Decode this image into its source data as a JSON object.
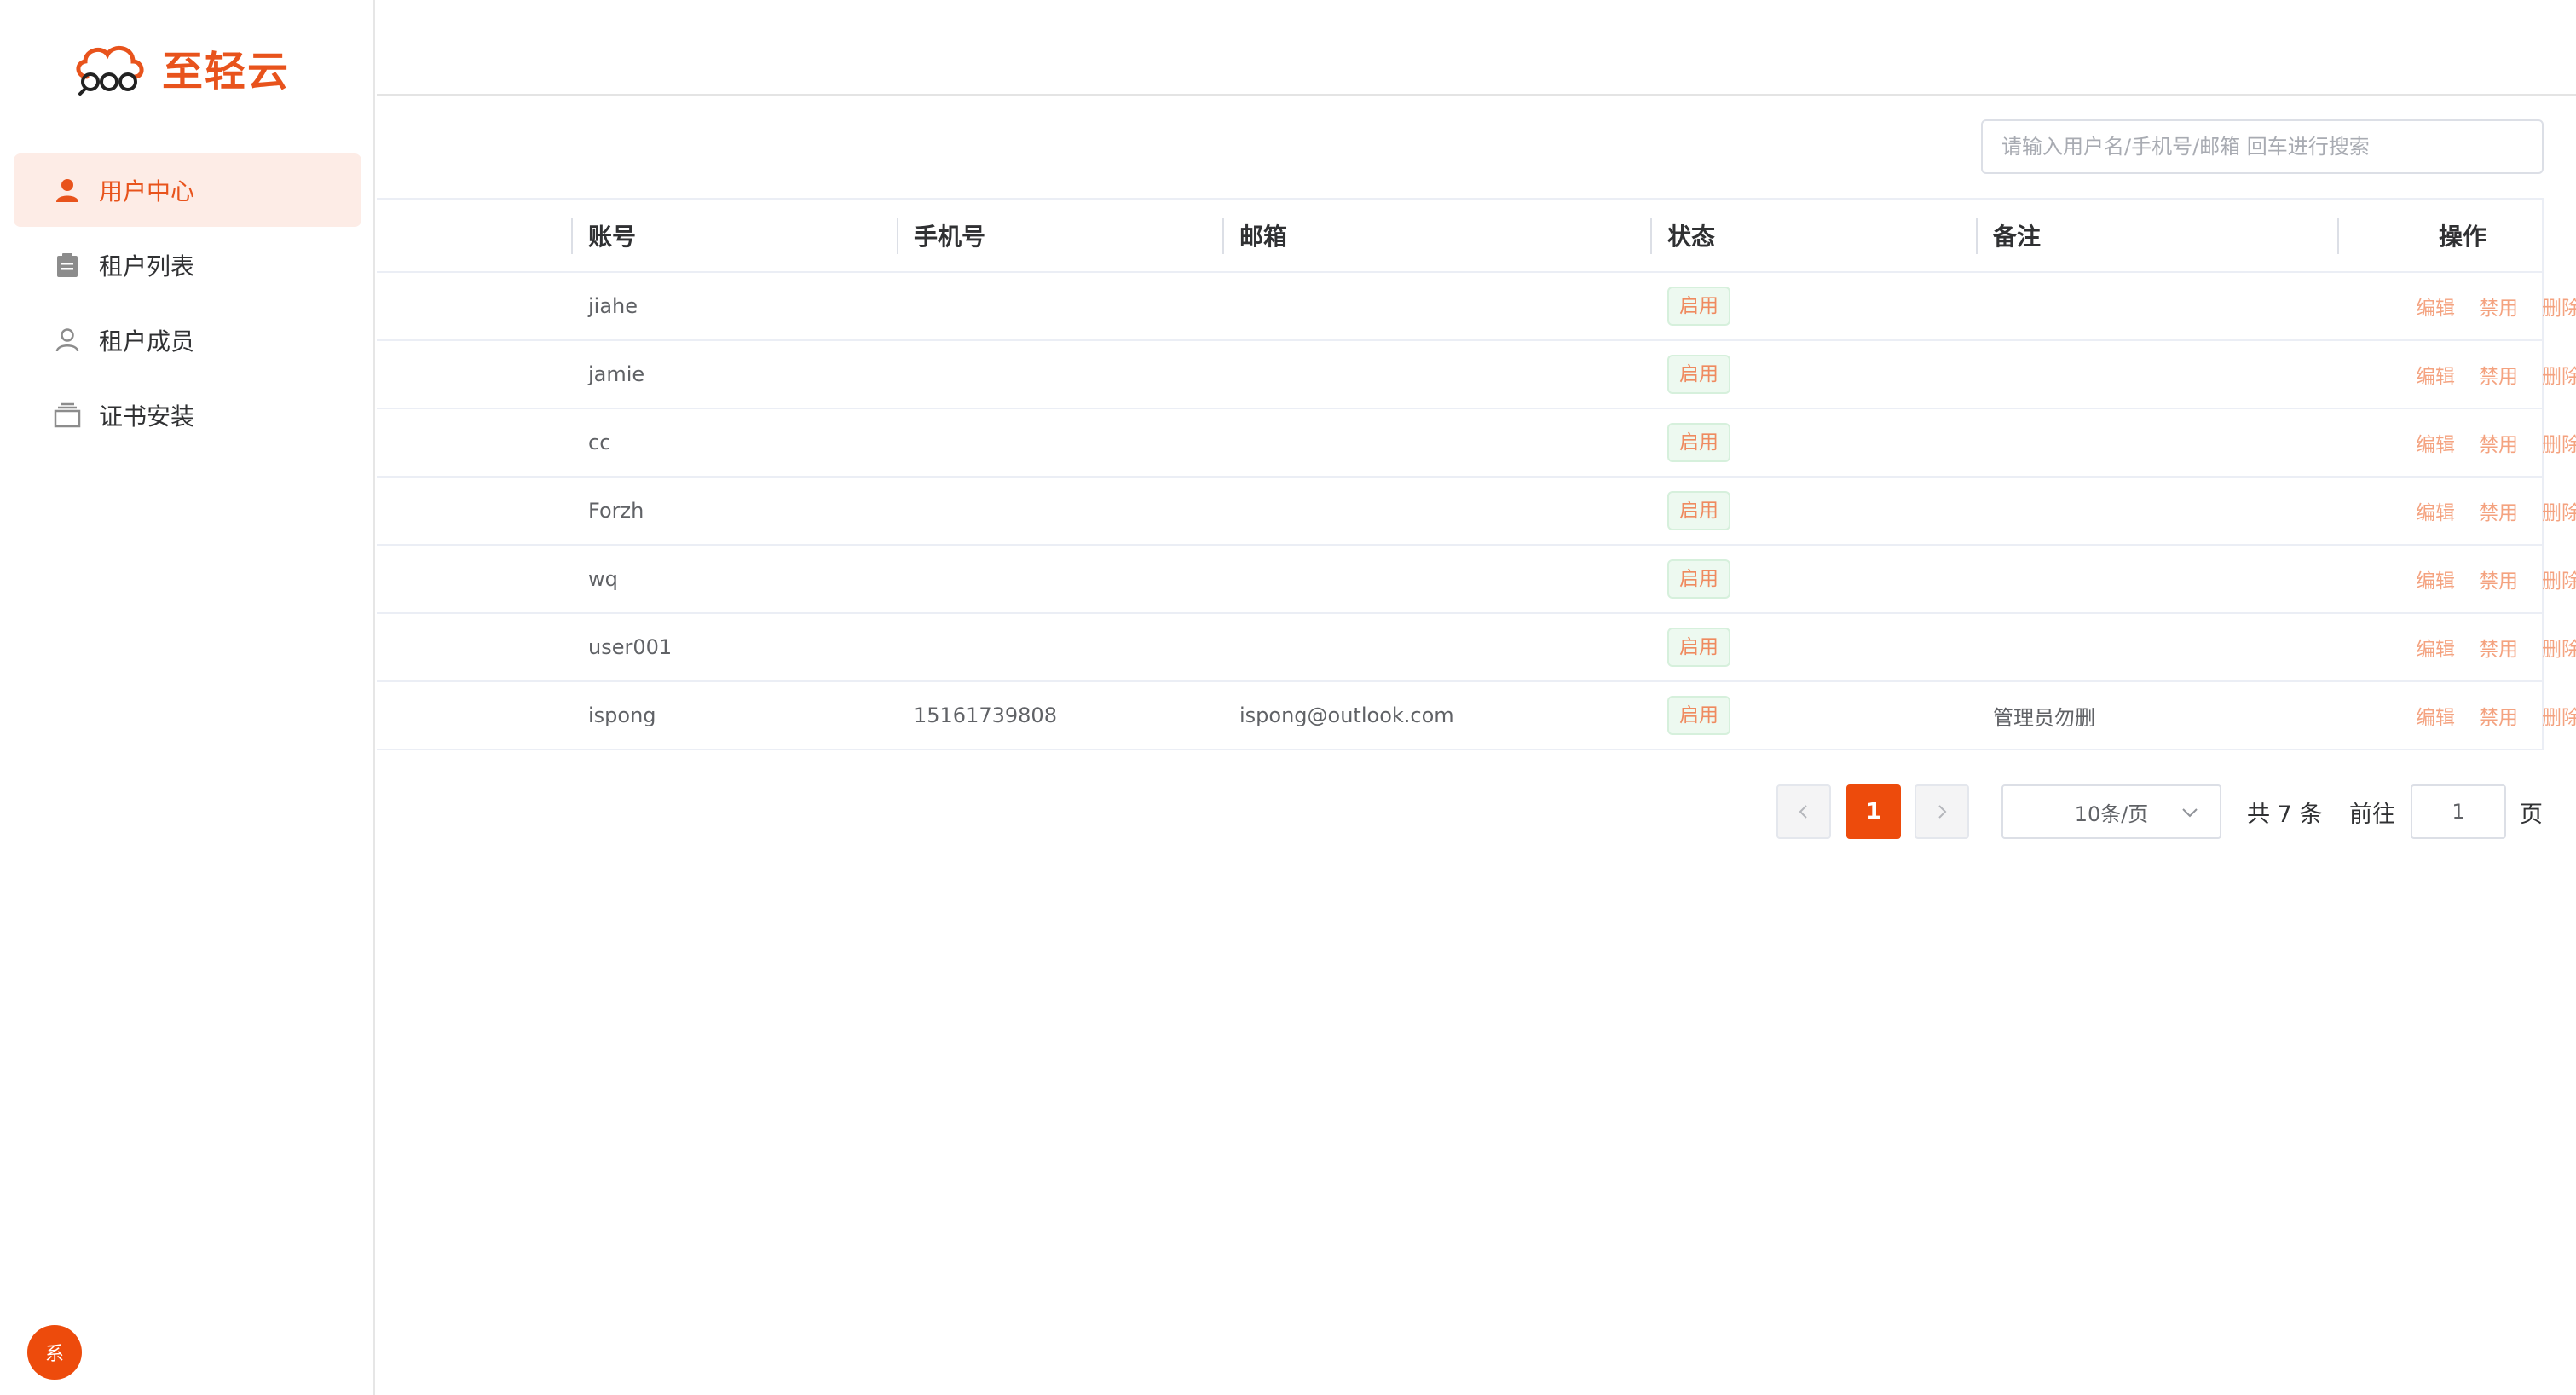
{
  "brand": {
    "name": "至轻云",
    "accent": "#e8531c"
  },
  "sidebar": {
    "items": [
      {
        "label": "用户中心",
        "icon": "user-filled-icon",
        "active": true
      },
      {
        "label": "租户列表",
        "icon": "clipboard-icon",
        "active": false
      },
      {
        "label": "租户成员",
        "icon": "user-outline-icon",
        "active": false
      },
      {
        "label": "证书安装",
        "icon": "box-icon",
        "active": false
      }
    ],
    "avatar_text": "系"
  },
  "search": {
    "placeholder": "请输入用户名/手机号/邮箱 回车进行搜索",
    "value": ""
  },
  "table": {
    "headers": {
      "account": "账号",
      "phone": "手机号",
      "email": "邮箱",
      "status": "状态",
      "note": "备注",
      "ops": "操作"
    },
    "ops": {
      "edit": "编辑",
      "disable": "禁用",
      "delete": "删除"
    },
    "rows": [
      {
        "account": "jiahe",
        "phone": "",
        "email": "",
        "status": "启用",
        "note": ""
      },
      {
        "account": "jamie",
        "phone": "",
        "email": "",
        "status": "启用",
        "note": ""
      },
      {
        "account": "cc",
        "phone": "",
        "email": "",
        "status": "启用",
        "note": ""
      },
      {
        "account": "Forzh",
        "phone": "",
        "email": "",
        "status": "启用",
        "note": ""
      },
      {
        "account": "wq",
        "phone": "",
        "email": "",
        "status": "启用",
        "note": ""
      },
      {
        "account": "user001",
        "phone": "",
        "email": "",
        "status": "启用",
        "note": ""
      },
      {
        "account": "ispong",
        "phone": "15161739808",
        "email": "ispong@outlook.com",
        "status": "启用",
        "note": "管理员勿删"
      }
    ]
  },
  "pagination": {
    "current_page": "1",
    "page_size": "10条/页",
    "total": "共 7 条",
    "goto_label": "前往",
    "goto_value": "1",
    "page_suffix": "页"
  }
}
